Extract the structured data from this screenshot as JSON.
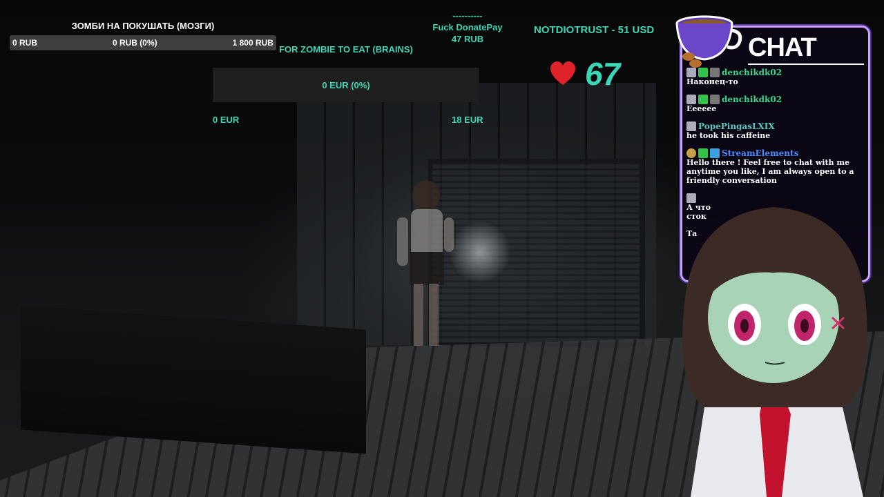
{
  "goal_ru": {
    "title": "ЗОМБИ НА ПОКУШАТЬ (МОЗГИ)",
    "min": "0 RUB",
    "current": "0 RUB (0%)",
    "max": "1 800 RUB",
    "progress_fraction": 0
  },
  "goal_en": {
    "title": "FOR ZOMBIE TO EAT (BRAINS)",
    "current": "0 EUR (0%)",
    "min": "0 EUR",
    "max": "18 EUR",
    "progress_fraction": 0
  },
  "last_donation": {
    "divider": "----------",
    "name": "Fuck DonatePay",
    "amount": "47 RUB"
  },
  "top_donation": "NOTDIOTRUST - 51 USD",
  "heart_counter": "67",
  "chat": {
    "title": "CHAT",
    "messages": [
      {
        "user": "denchikdk02",
        "text": "Наконец-то",
        "color": "#3ad68a"
      },
      {
        "user": "denchikdk02",
        "text": "Ееееее",
        "color": "#3ad68a"
      },
      {
        "user": "PopePingasLXIX",
        "text": "he took his caffeine",
        "color": "#56c8c0"
      },
      {
        "user": "StreamElements",
        "text": "Hello there ! Feel free to chat with me anytime you like, I am always open to a friendly conversation",
        "color": "#4f8cff"
      },
      {
        "user": "",
        "text": "А что",
        "color": "#3ad68a"
      },
      {
        "user": "",
        "text": "сток",
        "color": "#3ad68a"
      },
      {
        "user": "",
        "text": "Та",
        "color": "#3ad68a"
      }
    ]
  },
  "colors": {
    "accent": "#3ad6b6",
    "chat_border": "#c8a3ff",
    "heart": "#e0222a"
  }
}
